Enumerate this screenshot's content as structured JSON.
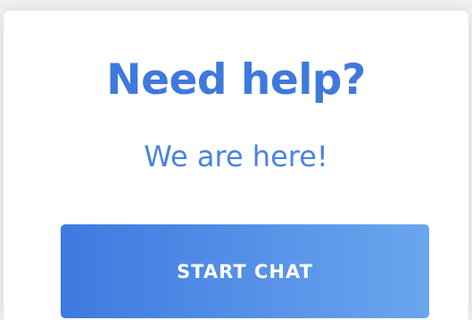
{
  "help_card": {
    "title": "Need help?",
    "subtitle": "We are here!",
    "button_label": "START CHAT"
  },
  "colors": {
    "title_blue": "#3f79dd",
    "subtitle_blue": "#4a84de",
    "button_gradient_start": "#3f79e0",
    "button_gradient_end": "#6aa6ee",
    "button_text": "#ffffff",
    "card_background": "#ffffff",
    "page_background": "#f0f0f1"
  }
}
